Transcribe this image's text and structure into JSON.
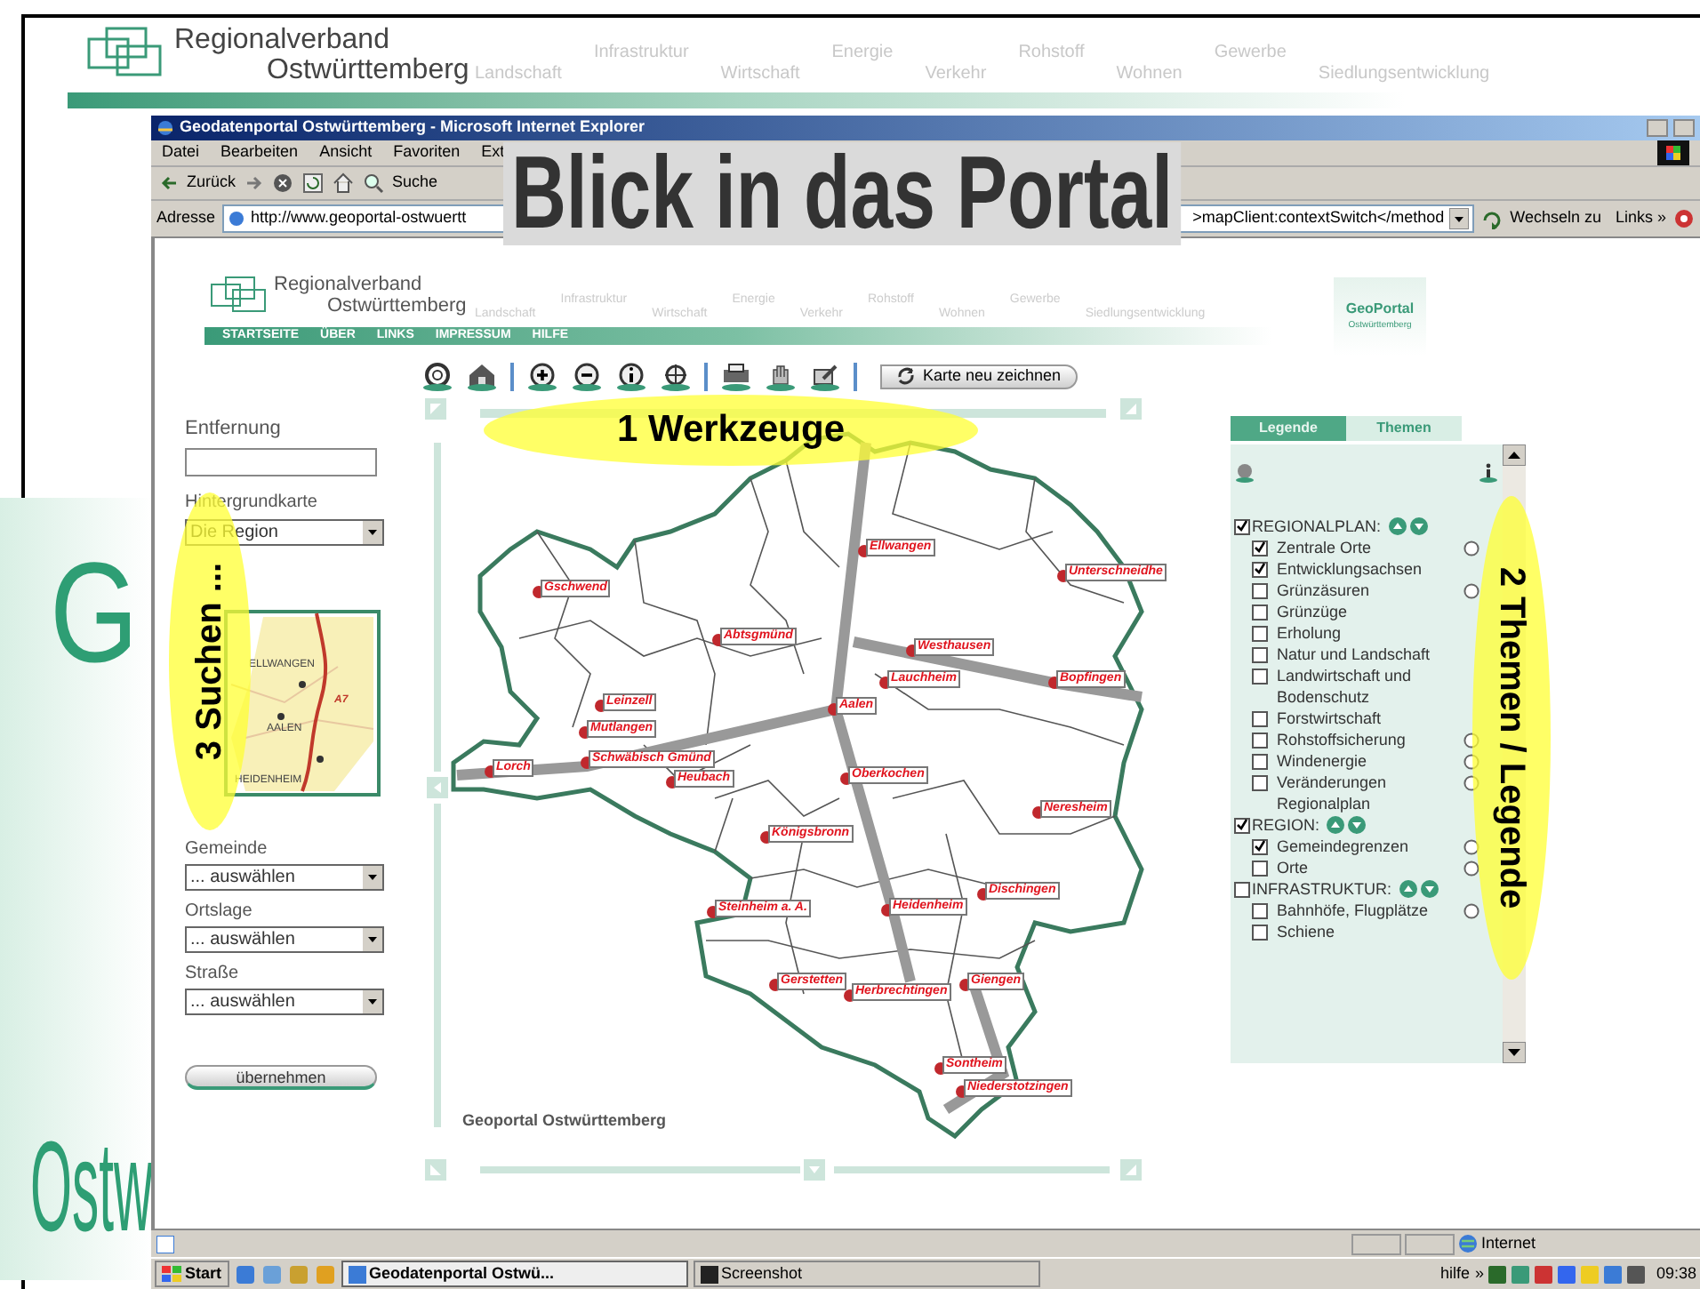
{
  "slide": {
    "logo": {
      "line_1": "Regionalverband",
      "line_2": "Ostwürttemberg"
    },
    "nav": [
      "Landschaft",
      "Infrastruktur",
      "Wirtschaft",
      "Energie",
      "Verkehr",
      "Rohstoff",
      "Wohnen",
      "Gewerbe",
      "Siedlungsentwicklung"
    ],
    "background_texts": [
      "G",
      "Ostw"
    ],
    "title": "Blick in das Portal",
    "callouts": [
      {
        "text": "1 Werkzeuge",
        "kind": "horizontal"
      },
      {
        "text": "2 Themen / Legende",
        "kind": "down"
      },
      {
        "text": "3 Suchen ...",
        "kind": "up"
      }
    ]
  },
  "browser": {
    "title": "Geodatenportal Ostwürttemberg - Microsoft Internet Explorer",
    "menu": [
      "Datei",
      "Bearbeiten",
      "Ansicht",
      "Favoriten",
      "Ext"
    ],
    "toolbar": {
      "back": "Zurück",
      "search": "Suche"
    },
    "address": {
      "label": "Adresse",
      "url_start": "http://www.geoportal-ostwuertt",
      "url_end": ">mapClient:contextSwitch</method",
      "go": "Wechseln zu",
      "links": "Links »"
    },
    "status": "Internet"
  },
  "portal": {
    "logo": {
      "line_1": "Regionalverband",
      "line_2": "Ostwürttemberg"
    },
    "nav": [
      "Landschaft",
      "Infrastruktur",
      "Wirtschaft",
      "Energie",
      "Verkehr",
      "Rohstoff",
      "Wohnen",
      "Gewerbe",
      "Siedlungsentwicklung"
    ],
    "menu": [
      "STARTSEITE",
      "ÜBER",
      "LINKS",
      "IMPRESSUM",
      "HILFE"
    ],
    "badge": {
      "name": "GeoPortal",
      "sub": "Ostwürttemberg"
    },
    "redraw_button": "Karte neu zeichnen",
    "search": {
      "distance_label": "Entfernung",
      "background_label": "Hintergrundkarte",
      "background_value": "Die Region",
      "overview_labels": [
        "ELLWANGEN",
        "AALEN",
        "HEIDENHEIM",
        "A7"
      ],
      "selects": [
        {
          "label": "Gemeinde",
          "value": "... auswählen"
        },
        {
          "label": "Ortslage",
          "value": "... auswählen"
        },
        {
          "label": "Straße",
          "value": "... auswählen"
        }
      ],
      "apply_button": "übernehmen"
    },
    "map": {
      "labels": [
        "Ellwangen",
        "Unterschneidhe",
        "Gschwend",
        "Abtsgmünd",
        "Westhausen",
        "Lauchheim",
        "Bopfingen",
        "Leinzell",
        "Mutlangen",
        "Aalen",
        "Lorch",
        "Schwäbisch Gmünd",
        "Heubach",
        "Oberkochen",
        "Neresheim",
        "Königsbronn",
        "Dischingen",
        "Steinheim a. A.",
        "Heidenheim",
        "Gerstetten",
        "Herbrechtingen",
        "Giengen",
        "Sontheim",
        "Niederstotzingen"
      ],
      "caption": "Geoportal Ostwürttemberg"
    },
    "panel": {
      "tabs": [
        {
          "label": "Legende",
          "selected": false
        },
        {
          "label": "Themen",
          "selected": true
        }
      ],
      "groups": [
        {
          "label": "REGIONALPLAN:",
          "checked": true,
          "children": [
            {
              "label": "Zentrale Orte",
              "checked": true,
              "radio_selected": false
            },
            {
              "label": "Entwicklungsachsen",
              "checked": true
            },
            {
              "label": "Grünzäsuren",
              "checked": false,
              "radio_selected": false
            },
            {
              "label": "Grünzüge",
              "checked": false
            },
            {
              "label": "Erholung",
              "checked": false
            },
            {
              "label": "Natur und Landschaft",
              "checked": false
            },
            {
              "label": "Landwirtschaft und Bodenschutz",
              "checked": false
            },
            {
              "label": "Forstwirtschaft",
              "checked": false
            },
            {
              "label": "Rohstoffsicherung",
              "checked": false,
              "radio_selected": false
            },
            {
              "label": "Windenergie",
              "checked": false,
              "radio_selected": false
            },
            {
              "label": "Veränderungen Regionalplan",
              "checked": false,
              "radio_selected": false
            }
          ]
        },
        {
          "label": "REGION:",
          "checked": true,
          "children": [
            {
              "label": "Gemeindegrenzen",
              "checked": true,
              "radio_selected": false
            },
            {
              "label": "Orte",
              "checked": false,
              "radio_selected": false
            }
          ]
        },
        {
          "label": "INFRASTRUKTUR:",
          "checked": false,
          "children": [
            {
              "label": "Bahnhöfe, Flugplätze",
              "checked": false,
              "radio_selected": false
            },
            {
              "label": "Schiene",
              "checked": false
            }
          ]
        }
      ]
    }
  },
  "taskbar": {
    "start": "Start",
    "tasks": [
      {
        "label": "Geodatenportal Ostwü...",
        "selected": true
      },
      {
        "label": "Screenshot",
        "selected": false
      }
    ],
    "tray_label": "hilfe",
    "more": "»",
    "clock": "09:38"
  }
}
